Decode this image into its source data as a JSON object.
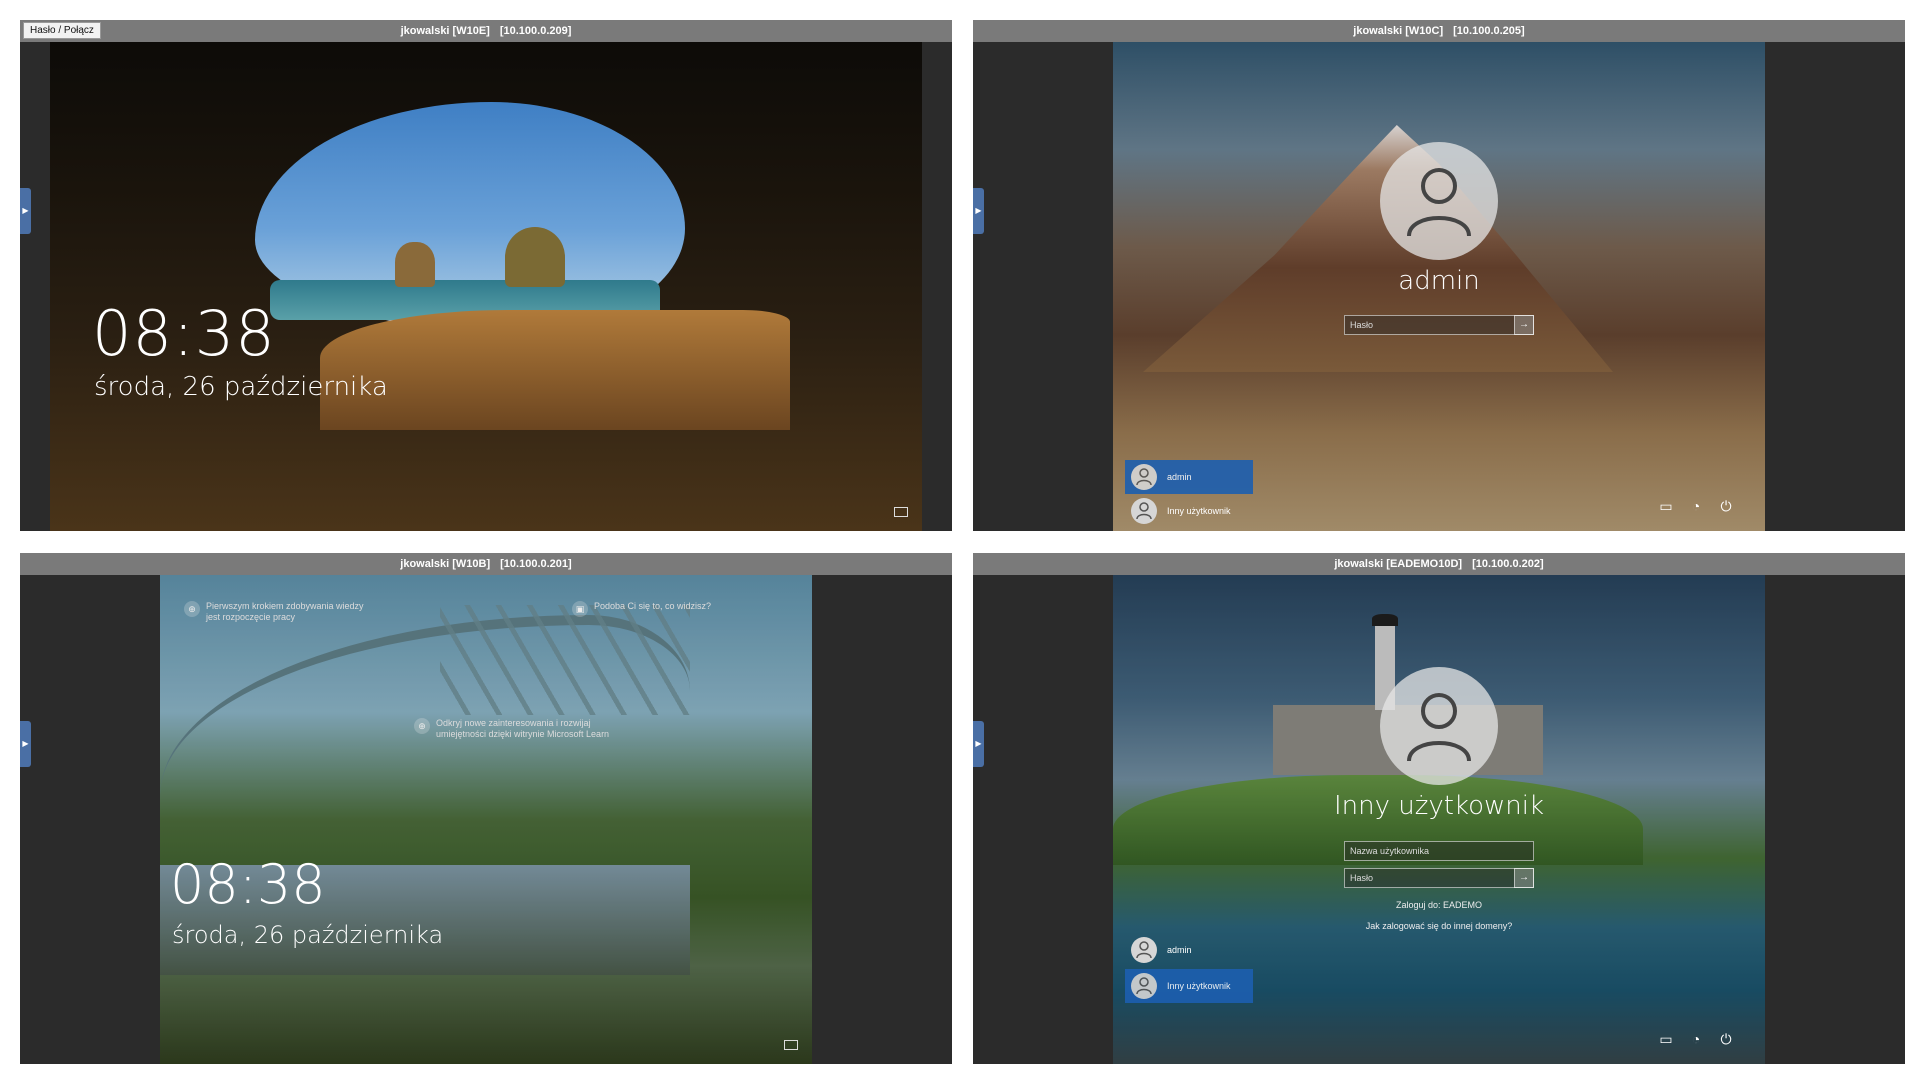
{
  "toolbar": {
    "connect_label": "Hasło / Połącz"
  },
  "sessions": [
    {
      "user": "jkowalski [W10E]",
      "ip": "[10.100.0.209]"
    },
    {
      "user": "jkowalski [W10C]",
      "ip": "[10.100.0.205]"
    },
    {
      "user": "jkowalski [W10B]",
      "ip": "[10.100.0.201]"
    },
    {
      "user": "jkowalski [EADEMO10D]",
      "ip": "[10.100.0.202]"
    }
  ],
  "lock": {
    "time": "08:38",
    "date": "środa, 26 października"
  },
  "login_w10c": {
    "username": "admin",
    "password_placeholder": "Hasło",
    "users": [
      "admin",
      "Inny użytkownik"
    ]
  },
  "login_eademo": {
    "username": "Inny użytkownik",
    "username_placeholder": "Nazwa użytkownika",
    "password_placeholder": "Hasło",
    "domain_text": "Zaloguj do: EADEMO",
    "other_domain_link": "Jak zalogować się do innej domeny?",
    "users": [
      "admin",
      "Inny użytkownik"
    ]
  },
  "spotlight": {
    "tip1": "Pierwszym krokiem zdobywania wiedzy jest rozpoczęcie pracy",
    "tip2": "Podoba Ci się to, co widzisz?",
    "tip3": "Odkryj nowe zainteresowania i rozwijaj umiejętności dzięki witrynie Microsoft Learn"
  },
  "icons": [
    "network-icon",
    "ease-of-access-icon",
    "power-icon",
    "user-icon"
  ]
}
